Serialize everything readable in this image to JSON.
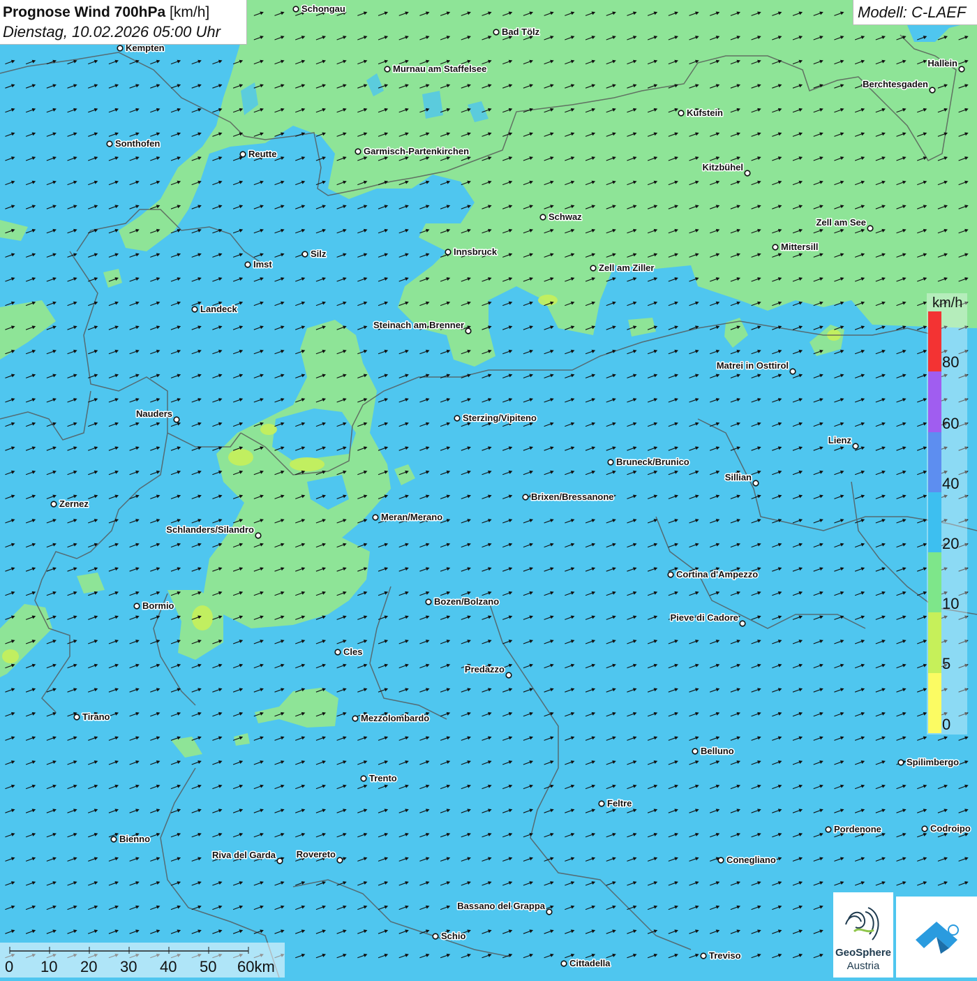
{
  "header": {
    "title_bold": "Prognose Wind 700hPa",
    "title_unit": "[km/h]",
    "datetime": "Dienstag, 10.02.2026 05:00 Uhr"
  },
  "model": {
    "label": "Modell: C-LAEF"
  },
  "legend": {
    "unit": "km/h",
    "ticks": [
      "80",
      "60",
      "40",
      "20",
      "10",
      "5",
      "0"
    ],
    "colors": [
      "#f33333",
      "#a05df0",
      "#5d8ef0",
      "#3dbff0",
      "#7ee68a",
      "#c6f05a",
      "#fbfb63"
    ]
  },
  "scalebar": {
    "labels": [
      "0",
      "10",
      "20",
      "30",
      "40",
      "50",
      "60km"
    ]
  },
  "logo": {
    "name": "GeoSphere",
    "sub": "Austria"
  },
  "colors": {
    "strong_wind": "#4fc6ef",
    "light_wind": "#8ee497",
    "border": "#555555"
  },
  "cities": [
    {
      "name": "Schongau"
    },
    {
      "name": "Kempten"
    },
    {
      "name": "Bad Tölz"
    },
    {
      "name": "Murnau am Staffelsee"
    },
    {
      "name": "Hallein"
    },
    {
      "name": "Berchtesgaden"
    },
    {
      "name": "Kufstein"
    },
    {
      "name": "Sonthofen"
    },
    {
      "name": "Reutte"
    },
    {
      "name": "Garmisch-Partenkirchen"
    },
    {
      "name": "Kitzbühel"
    },
    {
      "name": "Schwaz"
    },
    {
      "name": "Zell am See"
    },
    {
      "name": "Mittersill"
    },
    {
      "name": "Innsbruck"
    },
    {
      "name": "Silz"
    },
    {
      "name": "Imst"
    },
    {
      "name": "Zell am Ziller"
    },
    {
      "name": "Landeck"
    },
    {
      "name": "Steinach am Brenner"
    },
    {
      "name": "Matrei in Osttirol"
    },
    {
      "name": "Nauders"
    },
    {
      "name": "Sterzing/Vipiteno"
    },
    {
      "name": "Lienz"
    },
    {
      "name": "Bruneck/Brunico"
    },
    {
      "name": "Sillian"
    },
    {
      "name": "Brixen/Bressanone"
    },
    {
      "name": "Zernez"
    },
    {
      "name": "Meran/Merano"
    },
    {
      "name": "Schlanders/Silandro"
    },
    {
      "name": "Cortina d'Ampezzo"
    },
    {
      "name": "Bozen/Bolzano"
    },
    {
      "name": "Bormio"
    },
    {
      "name": "Pieve di Cadore"
    },
    {
      "name": "Cles"
    },
    {
      "name": "Predazzo"
    },
    {
      "name": "Tirano"
    },
    {
      "name": "Mezzolombardo"
    },
    {
      "name": "Belluno"
    },
    {
      "name": "Spilimbergo"
    },
    {
      "name": "Trento"
    },
    {
      "name": "Feltre"
    },
    {
      "name": "Pordenone"
    },
    {
      "name": "Codroipo"
    },
    {
      "name": "Bienno"
    },
    {
      "name": "Riva del Garda"
    },
    {
      "name": "Rovereto"
    },
    {
      "name": "Conegliano"
    },
    {
      "name": "Bassano del Grappa"
    },
    {
      "name": "Schio"
    },
    {
      "name": "Treviso"
    },
    {
      "name": "Cittadella"
    }
  ]
}
